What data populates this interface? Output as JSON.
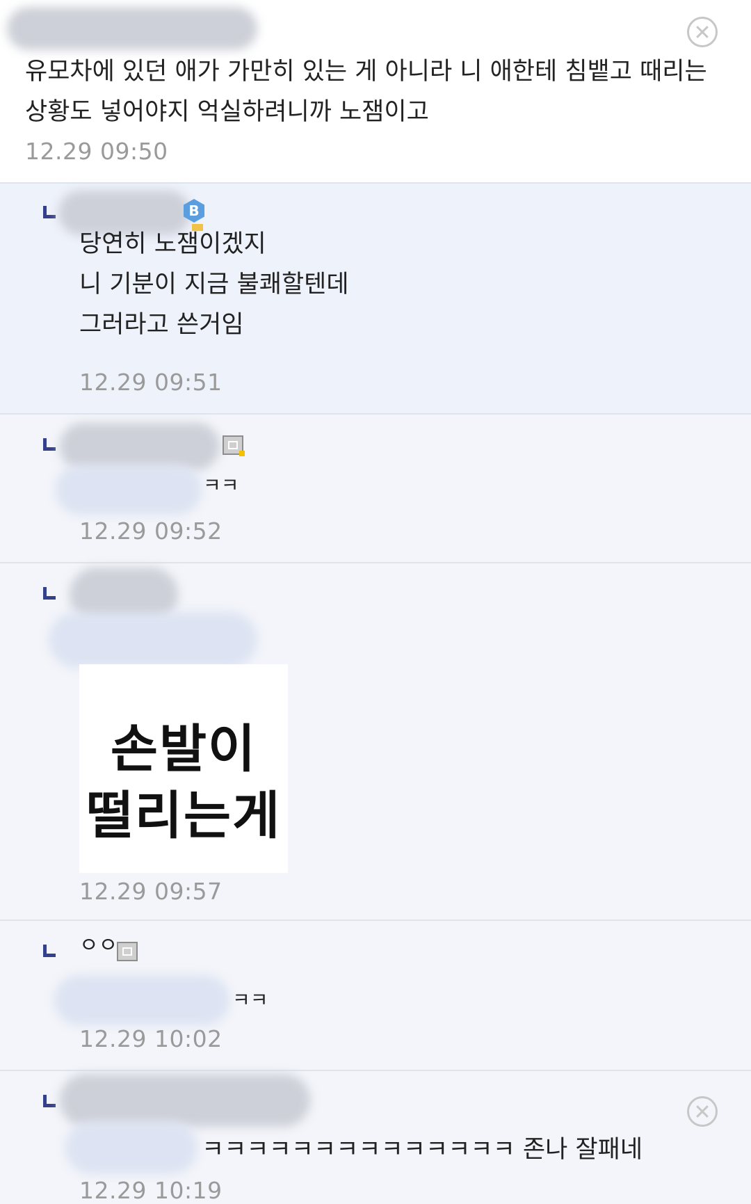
{
  "comments": [
    {
      "id": "c0",
      "text": "유모차에 있던 애가 가만히 있는 게 아니라 니 애한테 침뱉고 때리는\n상황도 넣어야지 억실하려니까 노잼이고",
      "time": "12.29 09:50"
    },
    {
      "id": "c1",
      "text": "당연히 노잼이겠지\n니 기분이 지금 불쾌할텐데\n그러라고 쓴거임",
      "time": "12.29 09:51",
      "badge": "B"
    },
    {
      "id": "c2",
      "text": "ㅋㅋ",
      "time": "12.29 09:52"
    },
    {
      "id": "c3",
      "sticker_lines": [
        "손발이",
        "떨리는게"
      ],
      "time": "12.29 09:57"
    },
    {
      "id": "c4",
      "nickname": "ㅇㅇ",
      "text": "ㅋㅋ",
      "time": "12.29 10:02"
    },
    {
      "id": "c5",
      "text": "ㅋㅋㅋㅋㅋㅋㅋㅋㅋㅋㅋㅋㅋㅋ 존나 잘패네",
      "time": "12.29 10:19"
    }
  ],
  "icons": {
    "close": "close-icon",
    "reply": "reply-arrow-icon",
    "level": "level-icon",
    "badge": "badge-icon"
  },
  "colors": {
    "highlight_bg": "#eef2fb",
    "reply_mark": "#35408a",
    "timestamp": "#9a9a9a"
  }
}
